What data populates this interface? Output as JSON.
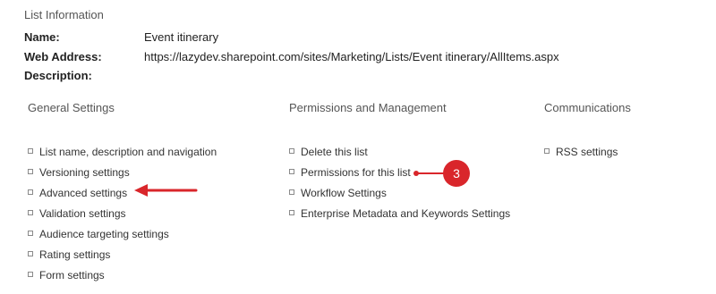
{
  "list_information": {
    "title": "List Information",
    "rows": [
      {
        "label": "Name:",
        "value": "Event itinerary"
      },
      {
        "label": "Web Address:",
        "value": "https://lazydev.sharepoint.com/sites/Marketing/Lists/Event itinerary/AllItems.aspx"
      },
      {
        "label": "Description:",
        "value": ""
      }
    ]
  },
  "general_settings": {
    "header": "General Settings",
    "links": [
      "List name, description and navigation",
      "Versioning settings",
      "Advanced settings",
      "Validation settings",
      "Audience targeting settings",
      "Rating settings",
      "Form settings"
    ]
  },
  "permissions_management": {
    "header": "Permissions and Management",
    "links": [
      "Delete this list",
      "Permissions for this list",
      "Workflow Settings",
      "Enterprise Metadata and Keywords Settings"
    ]
  },
  "communications": {
    "header": "Communications",
    "links": [
      "RSS settings"
    ]
  },
  "annotations": {
    "step_badge": "3",
    "accent_color": "#d9262b",
    "arrow_target": "Advanced settings",
    "badge_target": "Permissions for this list"
  }
}
